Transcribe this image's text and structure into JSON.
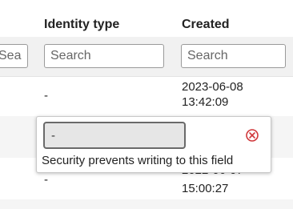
{
  "columns": {
    "identity_type": "Identity type",
    "created": "Created"
  },
  "filters": {
    "placeholder": "Search"
  },
  "rows": [
    {
      "identity_type": "-",
      "created_date": "2023-06-08",
      "created_time": "13:42:09"
    },
    {
      "identity_type": "",
      "created_date": "",
      "created_time": ""
    },
    {
      "identity_type": "-",
      "created_date": "2022-06-07",
      "created_time": "15:00:27"
    }
  ],
  "edit_popup": {
    "value": "-",
    "message": "Security prevents writing to this field",
    "close_color": "#d0373a"
  }
}
